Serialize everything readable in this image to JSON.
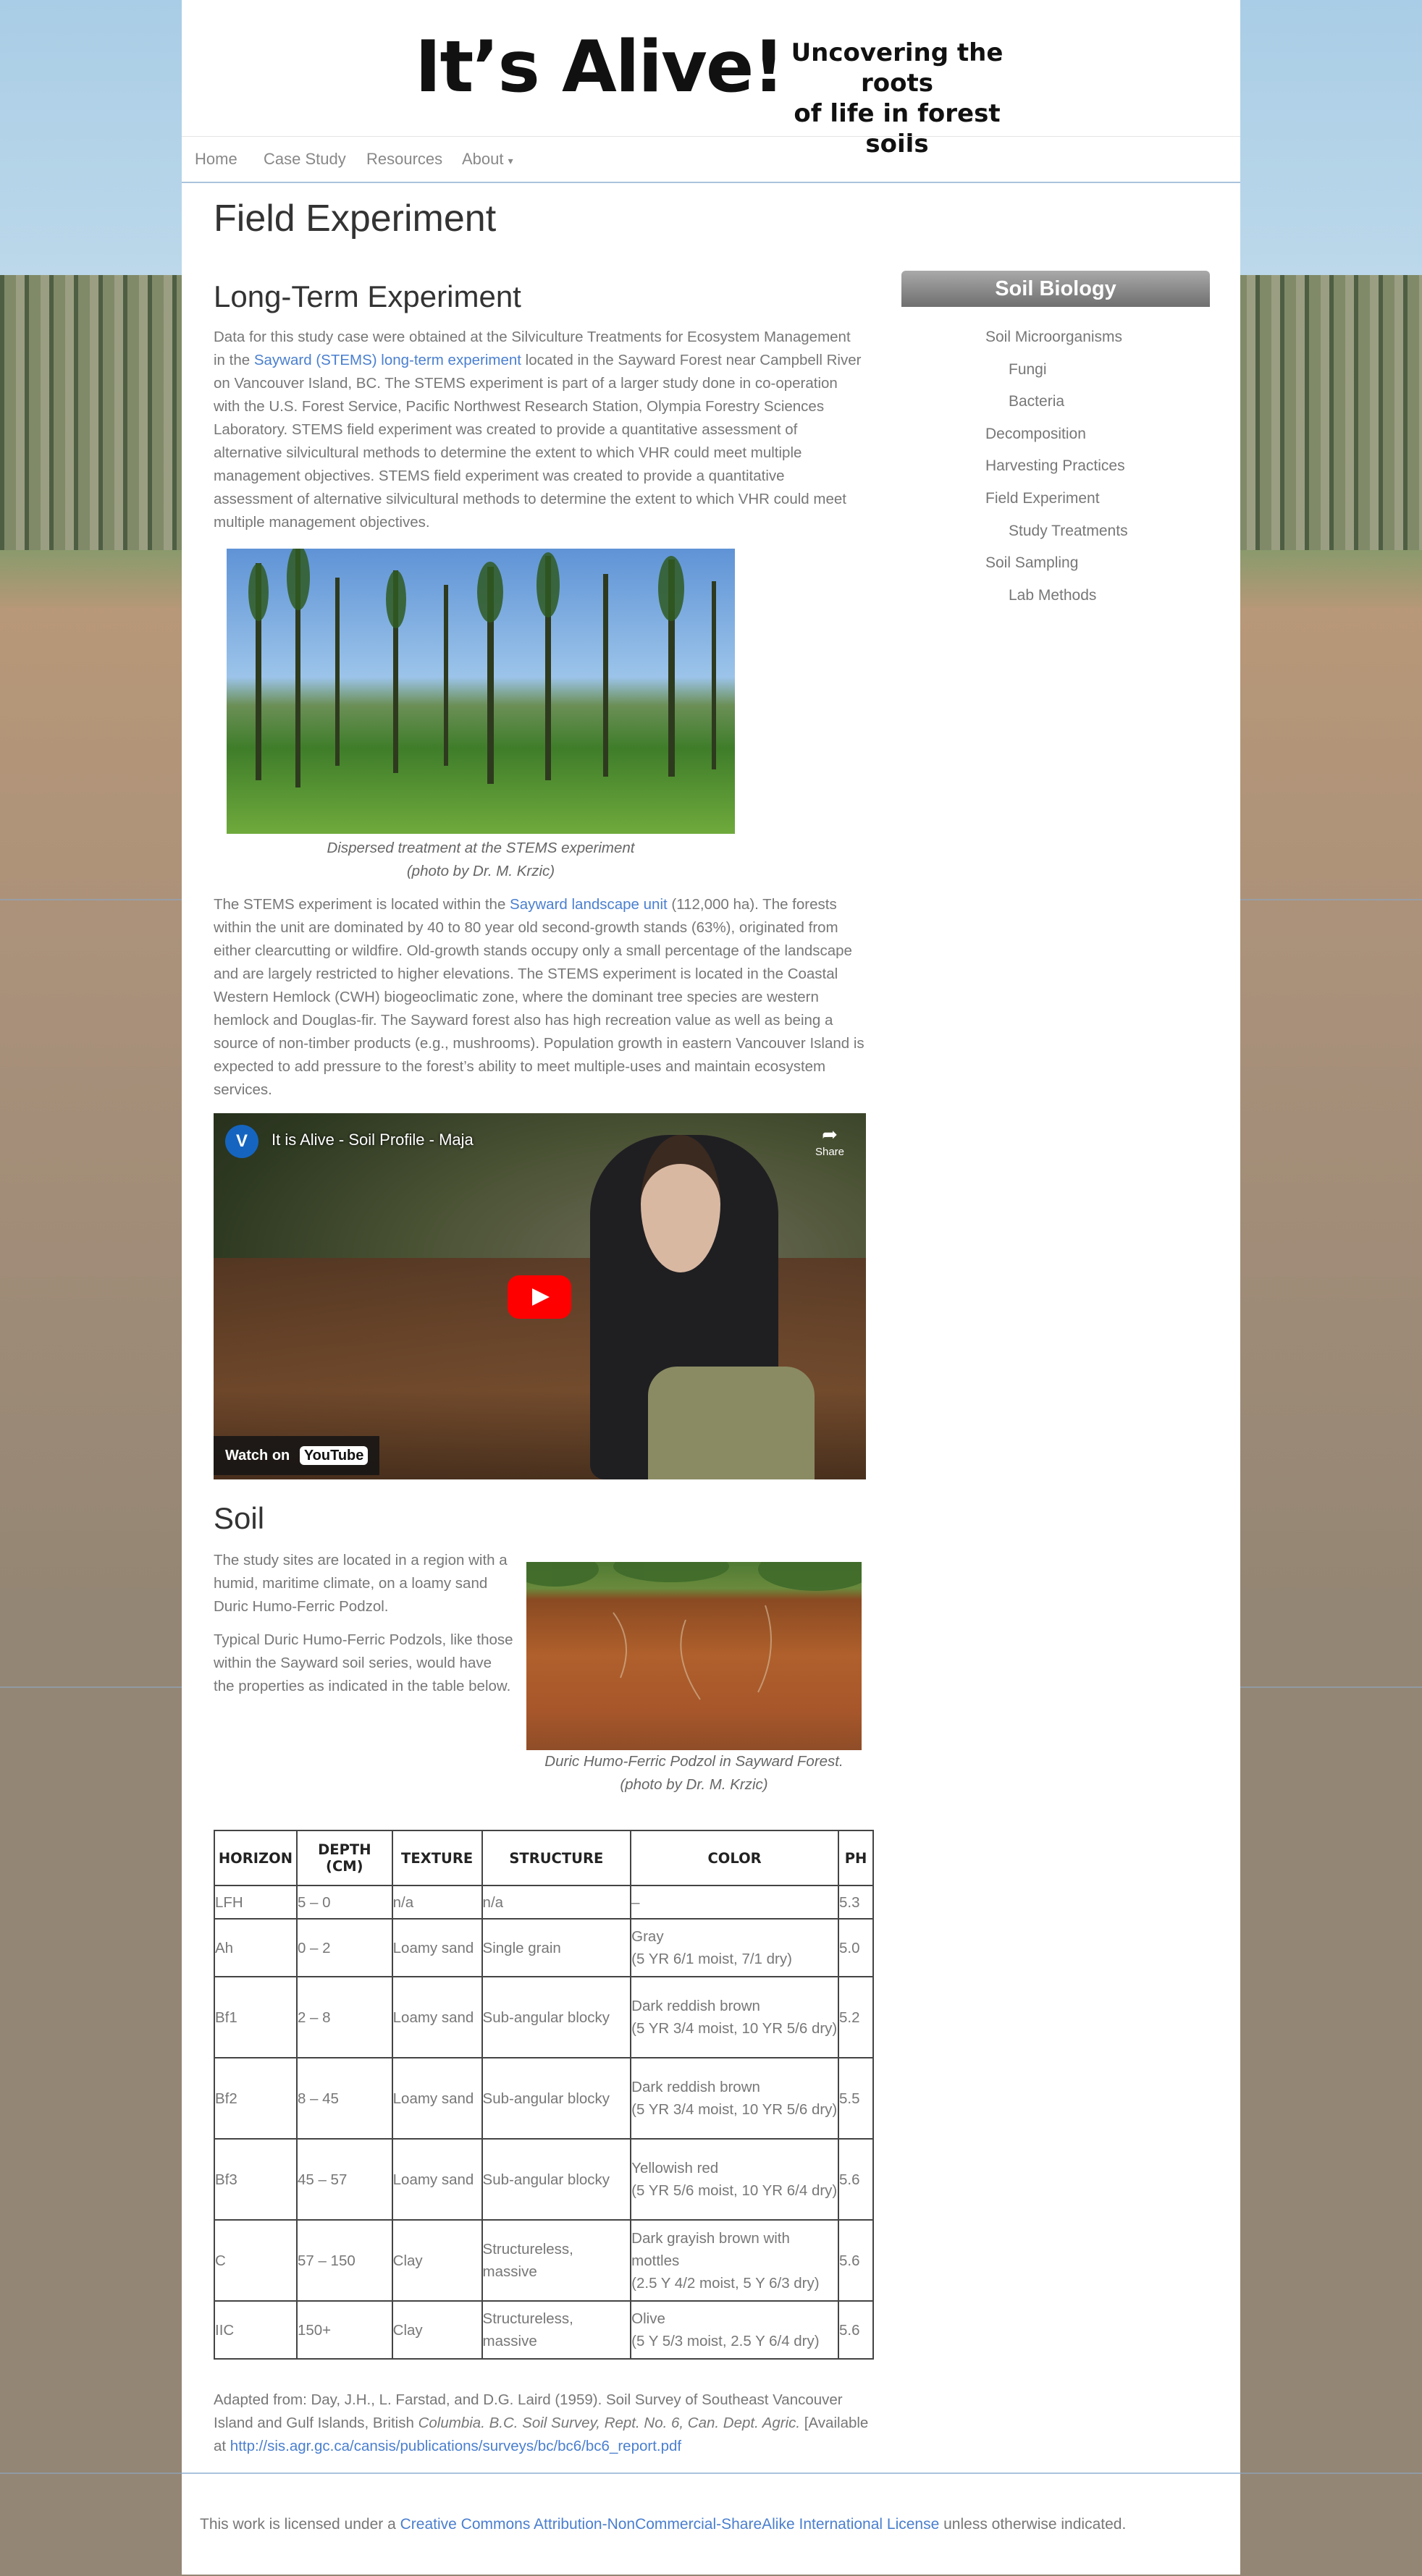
{
  "header": {
    "logo_title": "It’s Alive!",
    "logo_subtitle_line1": "Uncovering the roots",
    "logo_subtitle_line2": "of life in forest soils"
  },
  "nav": {
    "home": "Home",
    "case_study": "Case Study",
    "resources": "Resources",
    "about": "About",
    "about_caret": "▾"
  },
  "page_title": "Field Experiment",
  "section1": {
    "heading": "Long-Term Experiment",
    "p1_before": "Data for this study case were obtained at the Silviculture Treatments for Ecosystem Management in the ",
    "p1_link": "Sayward (STEMS) long-term experiment",
    "p1_after": " located in the Sayward Forest near Campbell River on Vancouver Island, BC. The STEMS experiment is part of a larger study done in co-operation with the U.S. Forest Service, Pacific Northwest Research Station, Olympia Forestry Sciences Laboratory. STEMS field experiment was created to provide a quantitative assessment of alternative silvicultural methods to determine the extent to which VHR could meet multiple management objectives. STEMS field experiment was created to provide a quantitative assessment of alternative silvicultural methods to determine the extent to which VHR could meet multiple management objectives.",
    "photo_caption_line1": "Dispersed treatment at the STEMS experiment",
    "photo_caption_line2": "(photo by Dr. M. Krzic)",
    "p2_before": "The STEMS experiment is located within the ",
    "p2_link": "Sayward landscape unit",
    "p2_after": " (112,000 ha). The forests within the unit are dominated by 40 to 80 year old second-growth stands (63%), originated from either clearcutting or wildfire. Old-growth stands occupy only a small percentage of the landscape and are largely restricted to higher elevations. The STEMS experiment is located in the Coastal Western Hemlock (CWH) biogeoclimatic zone, where the dominant tree species are western hemlock and Douglas-fir. The Sayward forest also has high recreation value as well as being a source of non-timber products (e.g., mushrooms). Population growth in eastern Vancouver Island is expected to add pressure to the forest’s ability to meet multiple-uses and maintain ecosystem services."
  },
  "video": {
    "channel_initial": "V",
    "title": "It is Alive - Soil Profile - Maja",
    "share": "Share",
    "watch_on": "Watch on",
    "platform": "YouTube"
  },
  "soil": {
    "heading": "Soil",
    "p1": "The study sites are located in a region with a humid, maritime climate, on a loamy sand Duric Humo-Ferric Podzol.",
    "p2": "Typical Duric Humo-Ferric Podzols, like those within the Sayward soil series, would have the properties as indicated in the table below.",
    "photo_caption_line1": "Duric Humo-Ferric Podzol in Sayward Forest.",
    "photo_caption_line2": "(photo by Dr. M. Krzic)"
  },
  "table": {
    "headers": [
      "HORIZON",
      "DEPTH (CM)",
      "TEXTURE",
      "STRUCTURE",
      "COLOR",
      "PH"
    ],
    "rows": [
      {
        "horizon": "LFH",
        "depth": "5 – 0",
        "texture": "n/a",
        "structure": "n/a",
        "color": "–",
        "ph": "5.3"
      },
      {
        "horizon": "Ah",
        "depth": "0 – 2",
        "texture": "Loamy sand",
        "structure": "Single grain",
        "color": "Gray\n(5 YR 6/1 moist, 7/1 dry)",
        "ph": "5.0"
      },
      {
        "horizon": "Bf1",
        "depth": "2 – 8",
        "texture": "Loamy sand",
        "structure": "Sub-angular blocky",
        "color": "Dark reddish brown\n(5 YR 3/4 moist, 10 YR 5/6 dry)",
        "ph": "5.2"
      },
      {
        "horizon": "Bf2",
        "depth": "8 – 45",
        "texture": "Loamy sand",
        "structure": "Sub-angular blocky",
        "color": "Dark reddish brown\n(5 YR 3/4 moist, 10 YR 5/6 dry)",
        "ph": "5.5"
      },
      {
        "horizon": "Bf3",
        "depth": "45 – 57",
        "texture": "Loamy sand",
        "structure": "Sub-angular blocky",
        "color": "Yellowish red\n(5 YR 5/6 moist, 10 YR 6/4 dry)",
        "ph": "5.6"
      },
      {
        "horizon": "C",
        "depth": "57 – 150",
        "texture": "Clay",
        "structure": "Structureless, massive",
        "color": "Dark grayish brown with mottles\n(2.5 Y 4/2 moist, 5 Y 6/3 dry)",
        "ph": "5.6"
      },
      {
        "horizon": "IIC",
        "depth": "150+",
        "texture": "Clay",
        "structure": "Structureless, massive",
        "color": "Olive\n(5 Y 5/3 moist, 2.5 Y 6/4 dry)",
        "ph": "5.6"
      }
    ]
  },
  "reference": {
    "text_before": "Adapted from: Day, J.H., L. Farstad, and D.G. Laird (1959). Soil Survey of Southeast Vancouver Island and Gulf Islands, British ",
    "text_italic": "Columbia. B.C. Soil Survey, Rept. No. 6, Can. Dept. Agric.",
    "text_after": " [Available at ",
    "link": "http://sis.agr.gc.ca/cansis/publications/surveys/bc/bc6/bc6_report.pdf"
  },
  "sidebar": {
    "title": "Soil Biology",
    "items": [
      {
        "label": "Soil Microorganisms",
        "level": 0
      },
      {
        "label": "Fungi",
        "level": 1
      },
      {
        "label": "Bacteria",
        "level": 1
      },
      {
        "label": "Decomposition",
        "level": 0
      },
      {
        "label": "Harvesting Practices",
        "level": 0
      },
      {
        "label": "Field Experiment",
        "level": 0
      },
      {
        "label": "Study Treatments",
        "level": 1
      },
      {
        "label": "Soil Sampling",
        "level": 0
      },
      {
        "label": "Lab Methods",
        "level": 1
      }
    ]
  },
  "footer": {
    "text_before": "This work is licensed under a ",
    "link": "Creative Commons Attribution-NonCommercial-ShareAlike International License",
    "text_after": " unless otherwise indicated."
  }
}
